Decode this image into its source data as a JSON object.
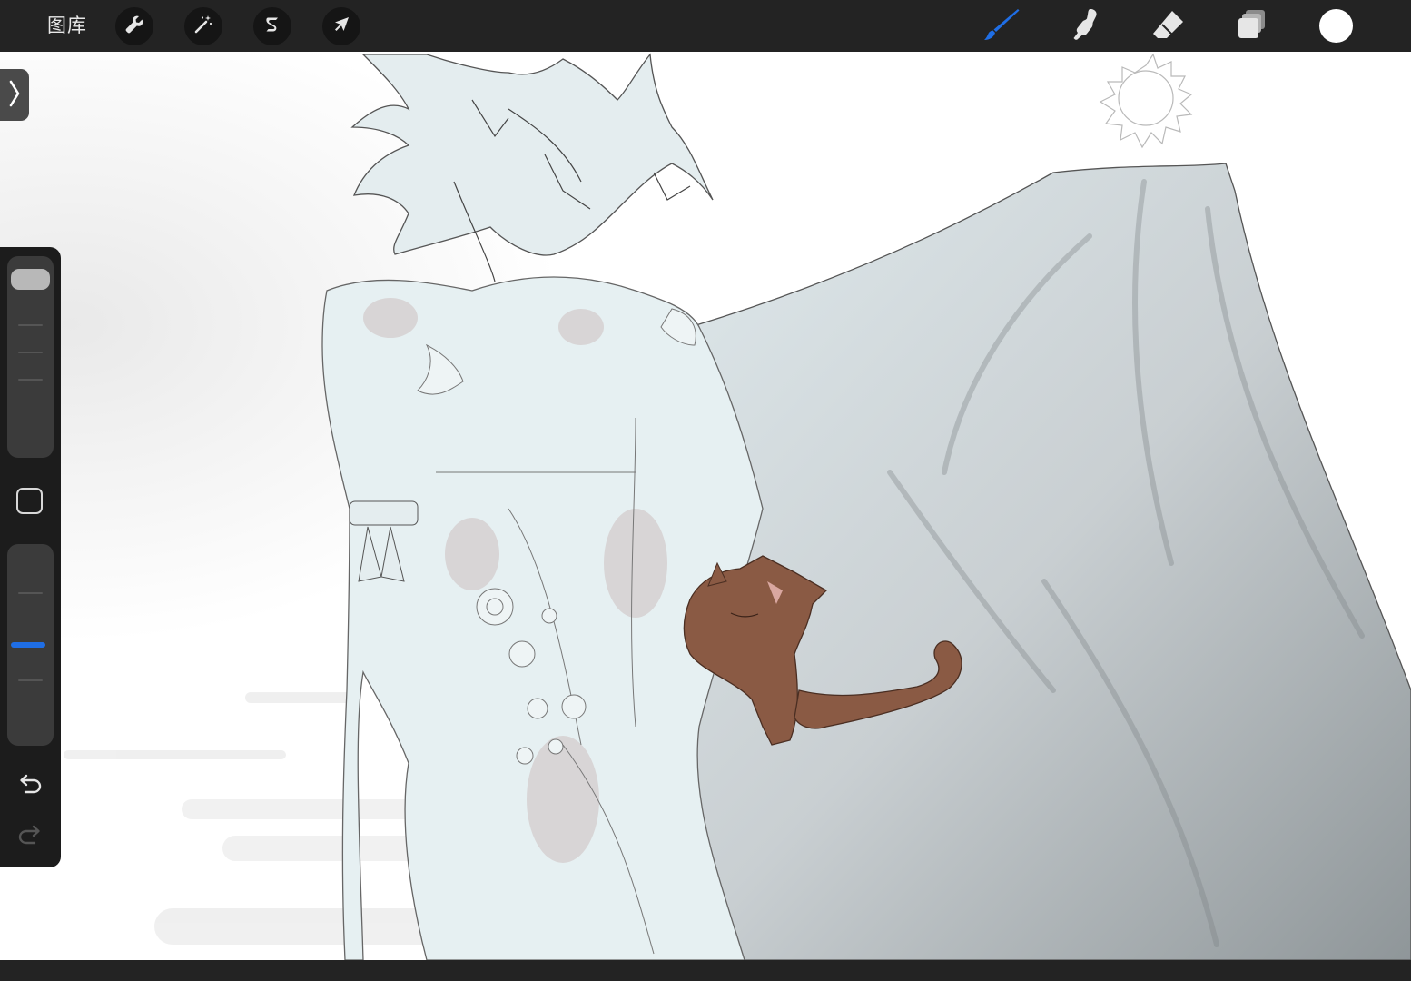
{
  "toolbar": {
    "gallery_label": "图库",
    "left_tools": [
      {
        "name": "actions-wrench",
        "icon": "wrench-icon"
      },
      {
        "name": "adjustments-magic-wand",
        "icon": "magic-wand-icon"
      },
      {
        "name": "selection",
        "icon": "selection-s-icon"
      },
      {
        "name": "transform",
        "icon": "transform-arrow-icon"
      }
    ],
    "right_tools": [
      {
        "name": "brush",
        "icon": "brush-icon",
        "active": true
      },
      {
        "name": "smudge",
        "icon": "smudge-icon",
        "active": false
      },
      {
        "name": "eraser",
        "icon": "eraser-icon",
        "active": false
      },
      {
        "name": "layers",
        "icon": "layers-icon",
        "active": false
      }
    ],
    "current_color": "#ffffff"
  },
  "sidebar": {
    "brush_size": 0.0,
    "brush_opacity": 0.5,
    "modify_button": "square-icon",
    "undo_icon": "undo-icon",
    "redo_icon": "redo-icon"
  },
  "colors": {
    "accent_blue": "#1f6ee5",
    "toolbar_bg": "#232323",
    "sidebar_bg": "#1c1c1c",
    "canvas_bg": "#ffffff",
    "figure_fill": "#e7f1f3",
    "cat_fill": "#8a5a44"
  }
}
